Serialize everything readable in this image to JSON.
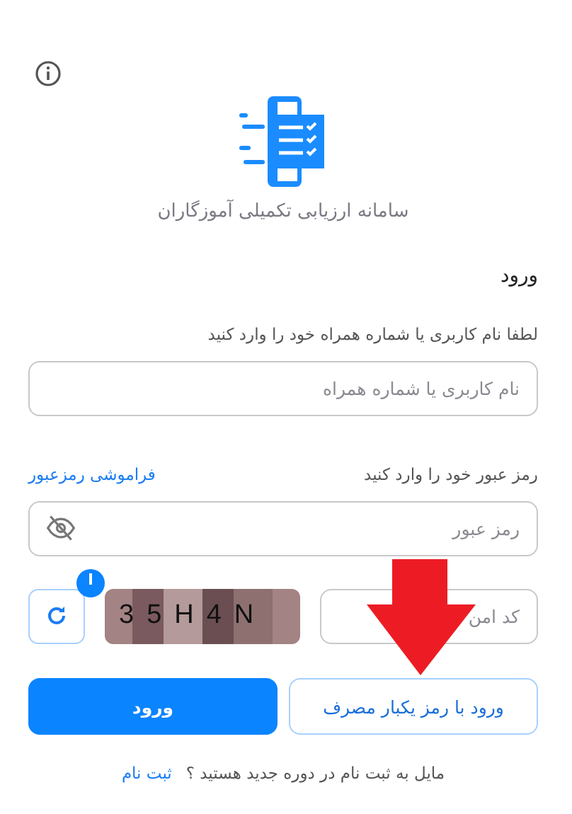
{
  "app_title": "سامانه ارزیابی تکمیلی آموزگاران",
  "form": {
    "heading": "ورود",
    "username": {
      "label": "لطفا نام کاربری یا شماره همراه خود را وارد کنید",
      "placeholder": "نام کاربری یا شماره همراه"
    },
    "password": {
      "label": "رمز عبور خود را وارد کنید",
      "forgot_link": "فراموشی رمزعبور",
      "placeholder": "رمز عبور"
    },
    "captcha": {
      "placeholder": "کد امن",
      "code": "35H4N"
    },
    "buttons": [
      {
        "label": "ورود با رمز یکبار مصرف",
        "kind": "outline"
      },
      {
        "label": "ورود",
        "kind": "primary"
      }
    ],
    "signup": {
      "question": "مایل به ثبت نام در دوره جدید هستید ؟",
      "link": "ثبت نام"
    }
  },
  "annotation": {
    "kind": "arrow"
  }
}
